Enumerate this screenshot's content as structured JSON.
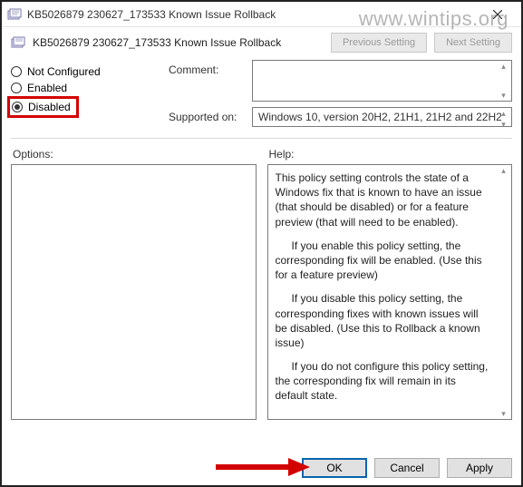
{
  "watermark": "www.wintips.org",
  "titlebar": {
    "title": "KB5026879 230627_173533 Known Issue Rollback"
  },
  "subheader": {
    "title": "KB5026879 230627_173533 Known Issue Rollback",
    "prev": "Previous Setting",
    "next": "Next Setting"
  },
  "radios": {
    "not_configured": "Not Configured",
    "enabled": "Enabled",
    "disabled": "Disabled",
    "selected": "disabled"
  },
  "fields": {
    "comment_label": "Comment:",
    "comment_value": "",
    "supported_label": "Supported on:",
    "supported_value": "Windows 10, version 20H2, 21H1, 21H2 and 22H2"
  },
  "panes": {
    "options_label": "Options:",
    "help_label": "Help:"
  },
  "help_paragraphs": [
    "This policy setting controls the state of a Windows fix that is known to have an issue (that should be disabled) or for a feature preview (that will need to be enabled).",
    "If you enable this policy setting, the corresponding fix will be enabled. (Use this for a feature preview)",
    "If you disable this policy setting, the corresponding fixes with known issues will be disabled. (Use this to Rollback a known issue)",
    "If you do not configure this policy setting, the corresponding fix will remain in its default state."
  ],
  "buttons": {
    "ok": "OK",
    "cancel": "Cancel",
    "apply": "Apply"
  }
}
